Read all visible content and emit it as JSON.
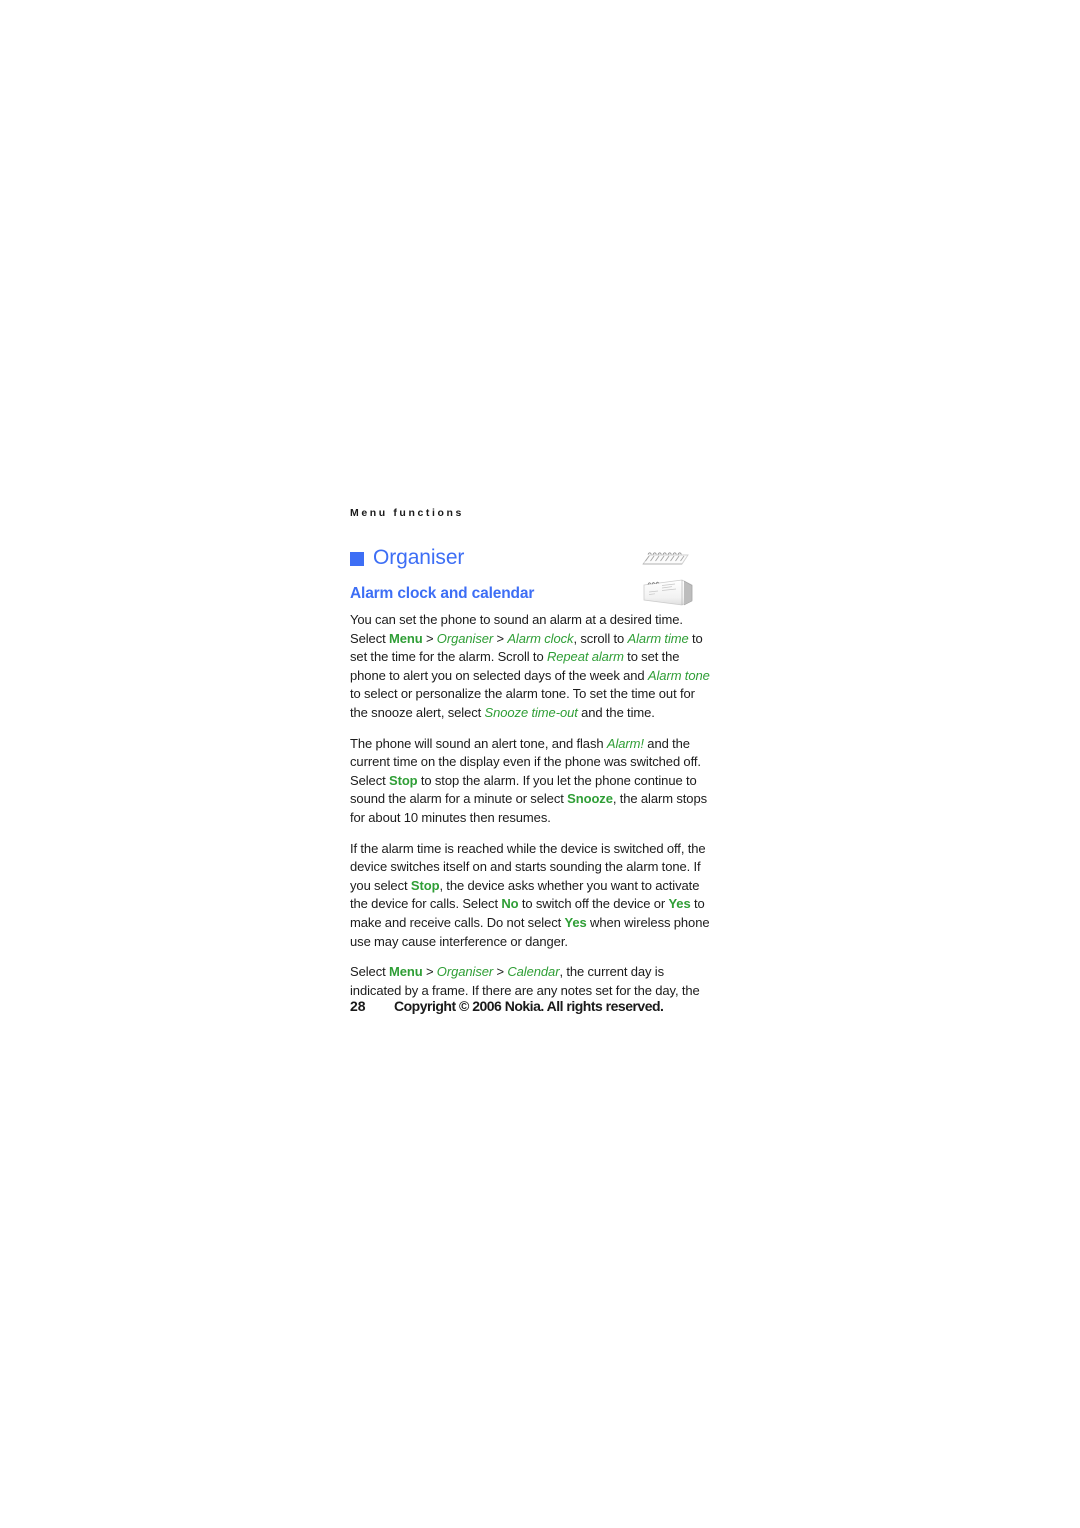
{
  "document": {
    "running_header": "Menu functions",
    "page_number": "28",
    "copyright": "Copyright © 2006 Nokia. All rights reserved."
  },
  "chapter": {
    "title": "Organiser",
    "bullet_color": "#3D6EF5"
  },
  "section": {
    "title": "Alarm clock and calendar",
    "color": "#3D6EF5"
  },
  "colors": {
    "heading_blue": "#3D6EF5",
    "ui_term_green": "#2F9E36",
    "body_text": "#1C1C1C",
    "page_background": "#FFFFFF"
  },
  "paragraphs": [
    {
      "id": "p1",
      "runs": [
        {
          "text": "You can set the phone to sound an alarm at a desired time. Select ",
          "style": "plain"
        },
        {
          "text": "Menu",
          "style": "key"
        },
        {
          "text": " > ",
          "style": "sep"
        },
        {
          "text": "Organiser",
          "style": "menu"
        },
        {
          "text": " > ",
          "style": "sep"
        },
        {
          "text": "Alarm clock",
          "style": "menu"
        },
        {
          "text": ", scroll to ",
          "style": "plain"
        },
        {
          "text": "Alarm time",
          "style": "menu"
        },
        {
          "text": " to set the time for the alarm. Scroll to ",
          "style": "plain"
        },
        {
          "text": "Repeat alarm",
          "style": "menu"
        },
        {
          "text": " to set the phone to alert you on selected days of the week and ",
          "style": "plain"
        },
        {
          "text": "Alarm tone",
          "style": "menu"
        },
        {
          "text": " to select or personalize the alarm tone. To set the time out for the snooze alert, select ",
          "style": "plain"
        },
        {
          "text": "Snooze time-out",
          "style": "menu"
        },
        {
          "text": " and the time.",
          "style": "plain"
        }
      ]
    },
    {
      "id": "p2",
      "runs": [
        {
          "text": "The phone will sound an alert tone, and flash ",
          "style": "plain"
        },
        {
          "text": "Alarm!",
          "style": "menu"
        },
        {
          "text": " and the current time on the display even if the phone was switched off. Select ",
          "style": "plain"
        },
        {
          "text": "Stop",
          "style": "key"
        },
        {
          "text": " to stop the alarm. If you let the phone continue to sound the alarm for a minute or select ",
          "style": "plain"
        },
        {
          "text": "Snooze",
          "style": "key"
        },
        {
          "text": ", the alarm stops for about 10 minutes then resumes.",
          "style": "plain"
        }
      ]
    },
    {
      "id": "p3",
      "runs": [
        {
          "text": "If the alarm time is reached while the device is switched off, the device switches itself on and starts sounding the alarm tone. If you select ",
          "style": "plain"
        },
        {
          "text": "Stop",
          "style": "key"
        },
        {
          "text": ", the device asks whether you want to activate the device for calls. Select ",
          "style": "plain"
        },
        {
          "text": "No",
          "style": "key"
        },
        {
          "text": " to switch off the device or ",
          "style": "plain"
        },
        {
          "text": "Yes",
          "style": "key"
        },
        {
          "text": " to make and receive calls. Do not select ",
          "style": "plain"
        },
        {
          "text": "Yes",
          "style": "key"
        },
        {
          "text": " when wireless phone use may cause interference or danger.",
          "style": "plain"
        }
      ]
    },
    {
      "id": "p4",
      "runs": [
        {
          "text": "Select ",
          "style": "plain"
        },
        {
          "text": "Menu",
          "style": "key"
        },
        {
          "text": " > ",
          "style": "sep"
        },
        {
          "text": "Organiser",
          "style": "menu"
        },
        {
          "text": " > ",
          "style": "sep"
        },
        {
          "text": "Calendar",
          "style": "menu"
        },
        {
          "text": ", the current day is indicated by a frame. If there are any notes set for the day, the",
          "style": "plain"
        }
      ]
    }
  ],
  "figures": [
    {
      "name": "spiral-calendar-top-view",
      "alt": "faint grayscale spiral bound calendar seen edge on"
    },
    {
      "name": "spiral-calendar-angled-view",
      "alt": "faint grayscale spiral bound calendar seen at an angle"
    }
  ]
}
